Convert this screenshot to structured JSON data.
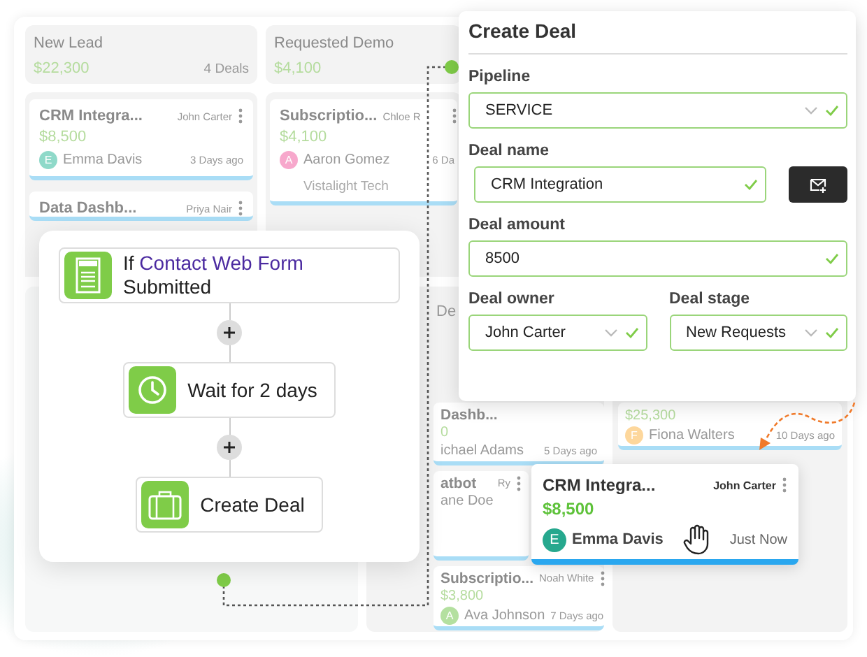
{
  "board": {
    "columns": [
      {
        "header": {
          "title": "New Lead",
          "amount": "$22,300",
          "count": "4 Deals"
        },
        "cards": [
          {
            "title": "CRM Integra...",
            "owner": "John Carter",
            "amount": "$8,500",
            "initial": "E",
            "color": "#8fd9c9",
            "contact": "Emma Davis",
            "time": "3 Days ago"
          },
          {
            "title": "Data Dashb...",
            "owner": "Priya Nair"
          }
        ]
      },
      {
        "header": {
          "title": "Requested Demo",
          "amount": "$4,100"
        },
        "cards": [
          {
            "title": "Subscriptio...",
            "owner": "Chloe R",
            "amount": "$4,100",
            "initial": "A",
            "color": "#f7a8cc",
            "contact": "Aaron Gomez",
            "company": "Vistalight Tech",
            "time": "6 Da"
          }
        ],
        "section_header": "De",
        "lower_cards": [
          {
            "title": "Dashb...",
            "amount": "0",
            "contact": "ichael Adams",
            "time": "5 Days ago"
          },
          {
            "title": "atbot",
            "owner": "Ry",
            "contact": "ane Doe"
          },
          {
            "title": "Subscriptio...",
            "owner": "Noah White",
            "amount": "$3,800",
            "initial": "A",
            "color": "#b4e0a0",
            "contact": "Ava Johnson",
            "time": "7 Days ago"
          }
        ]
      },
      {
        "cards": [
          {
            "amount": "$25,300",
            "initial": "F",
            "color": "#fdd79c",
            "contact": "Fiona Walters",
            "time": "10 Days ago"
          }
        ]
      }
    ]
  },
  "workflow": {
    "steps": [
      {
        "kind": "form",
        "prefix": "If",
        "link": "Contact Web Form",
        "text": "Submitted"
      },
      {
        "kind": "wait",
        "text": "Wait for 2 days"
      },
      {
        "kind": "deal",
        "text": "Create Deal"
      }
    ]
  },
  "create_deal": {
    "title": "Create Deal",
    "fields": [
      {
        "label": "Pipeline",
        "value": "SERVICE",
        "kind": "select",
        "valid": true
      },
      {
        "label": "Deal name",
        "value": "CRM Integration",
        "kind": "text",
        "valid": true
      },
      {
        "label": "Deal amount",
        "value": "8500",
        "kind": "text",
        "valid": true
      },
      {
        "label": "Deal owner",
        "value": "John Carter",
        "kind": "select",
        "valid": true
      },
      {
        "label": "Deal stage",
        "value": "New Requests",
        "kind": "select",
        "valid": true
      }
    ]
  },
  "dragged_card": {
    "title": "CRM Integra...",
    "owner": "John Carter",
    "amount": "$8,500",
    "initial": "E",
    "color": "#26a88e",
    "contact": "Emma Davis",
    "time": "Just Now"
  }
}
